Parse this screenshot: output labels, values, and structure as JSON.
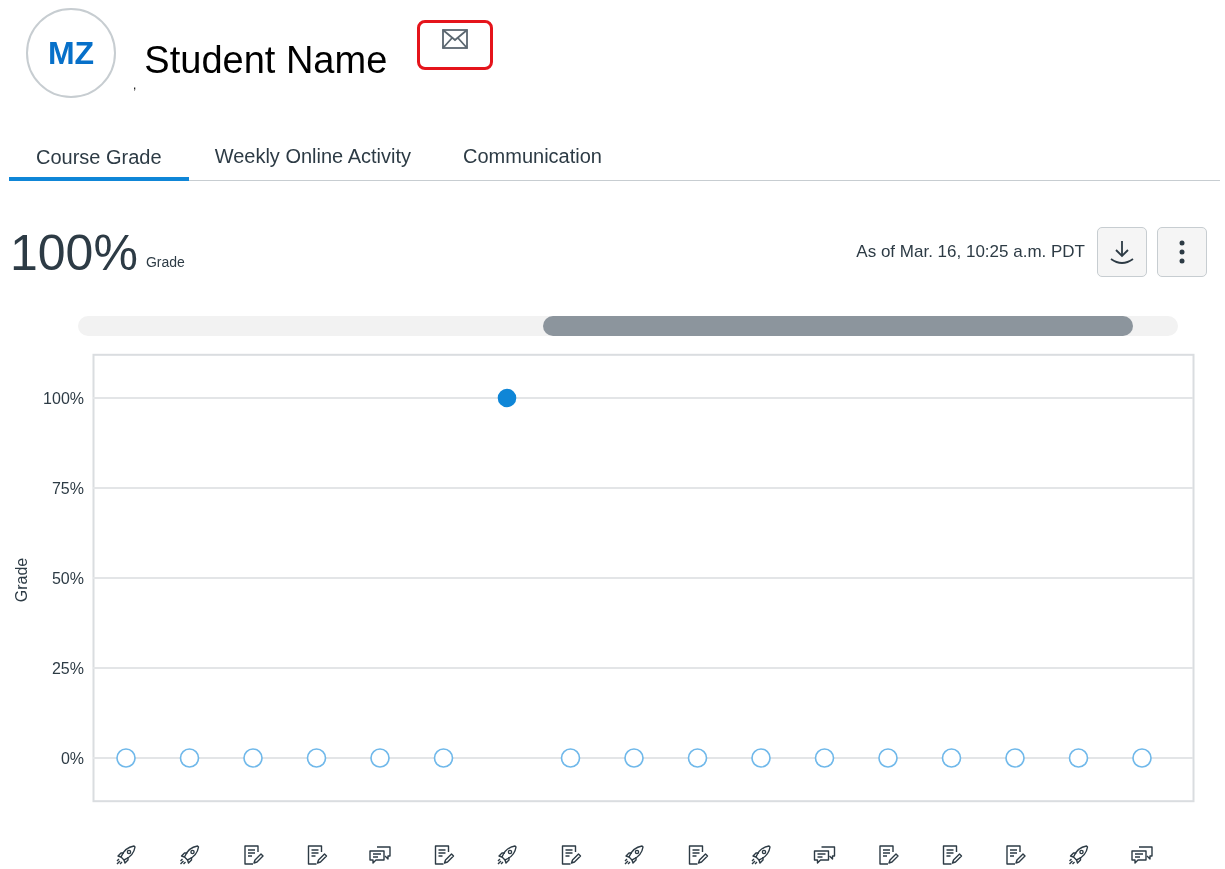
{
  "student": {
    "initials": "MZ",
    "name": "Student Name",
    "stray_mark": ","
  },
  "tabs": [
    {
      "label": "Course Grade",
      "selected": true
    },
    {
      "label": "Weekly Online Activity",
      "selected": false
    },
    {
      "label": "Communication",
      "selected": false
    }
  ],
  "grade": {
    "value": "100%",
    "label": "Grade",
    "as_of": "As of Mar. 16, 10:25 a.m. PDT"
  },
  "chart": {
    "chart_data": {
      "type": "scatter",
      "ylabel": "Grade",
      "grid": true,
      "values": [
        0,
        0,
        0,
        0,
        0,
        0,
        100,
        0,
        0,
        0,
        0,
        0,
        0,
        0,
        0,
        0,
        0
      ],
      "ylim": [
        -12,
        112
      ],
      "yticks": [
        {
          "value": 0,
          "label": "0%"
        },
        {
          "value": 25,
          "label": "25%"
        },
        {
          "value": 50,
          "label": "50%"
        },
        {
          "value": 75,
          "label": "75%"
        },
        {
          "value": 100,
          "label": "100%"
        }
      ]
    },
    "assignments": [
      {
        "kind": "quiz",
        "filled": false
      },
      {
        "kind": "quiz",
        "filled": false
      },
      {
        "kind": "assignment",
        "filled": false
      },
      {
        "kind": "assignment",
        "filled": false
      },
      {
        "kind": "discussion",
        "filled": false
      },
      {
        "kind": "assignment",
        "filled": false
      },
      {
        "kind": "quiz",
        "filled": true
      },
      {
        "kind": "assignment",
        "filled": false
      },
      {
        "kind": "quiz",
        "filled": false
      },
      {
        "kind": "assignment",
        "filled": false
      },
      {
        "kind": "quiz",
        "filled": false
      },
      {
        "kind": "discussion",
        "filled": false
      },
      {
        "kind": "assignment",
        "filled": false
      },
      {
        "kind": "assignment",
        "filled": false
      },
      {
        "kind": "assignment",
        "filled": false
      },
      {
        "kind": "quiz",
        "filled": false
      },
      {
        "kind": "discussion",
        "filled": false
      }
    ]
  }
}
